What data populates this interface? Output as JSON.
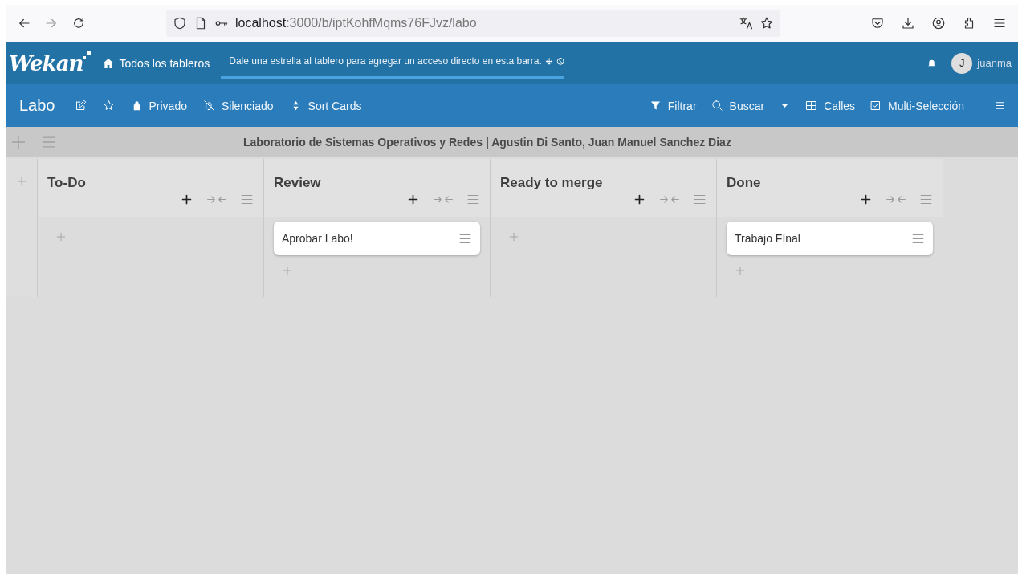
{
  "browser": {
    "url_host": "localhost",
    "url_path": ":3000/b/iptKohfMqms76FJvz/labo"
  },
  "header": {
    "logo": "Wekan",
    "home_link": "Todos los tableros",
    "announcement": "Dale una estrella al tablero para agregar un acceso directo en esta barra.",
    "user": {
      "initial": "J",
      "name": "juanma"
    }
  },
  "board_bar": {
    "title": "Labo",
    "left_items": [
      {
        "kind": "edit"
      },
      {
        "kind": "star"
      },
      {
        "kind": "lock",
        "label": "Privado"
      },
      {
        "kind": "bell-off",
        "label": "Silenciado"
      },
      {
        "kind": "sort",
        "label": "Sort Cards"
      }
    ],
    "right_items": [
      {
        "kind": "filter",
        "label": "Filtrar"
      },
      {
        "kind": "search",
        "label": "Buscar"
      },
      {
        "kind": "caret"
      },
      {
        "kind": "grid",
        "label": "Calles"
      },
      {
        "kind": "checkbox",
        "label": "Multi-Selección"
      }
    ]
  },
  "swimlane": {
    "title": "Laboratorio de Sistemas Operativos y Redes | Agustin Di Santo, Juan Manuel Sanchez Diaz"
  },
  "lists": [
    {
      "title": "To-Do"
    },
    {
      "title": "Review",
      "cards": [
        {
          "title": "Aprobar Labo!"
        }
      ]
    },
    {
      "title": "Ready to merge"
    },
    {
      "title": "Done",
      "cards": [
        {
          "title": "Trabajo FInal"
        }
      ]
    }
  ]
}
